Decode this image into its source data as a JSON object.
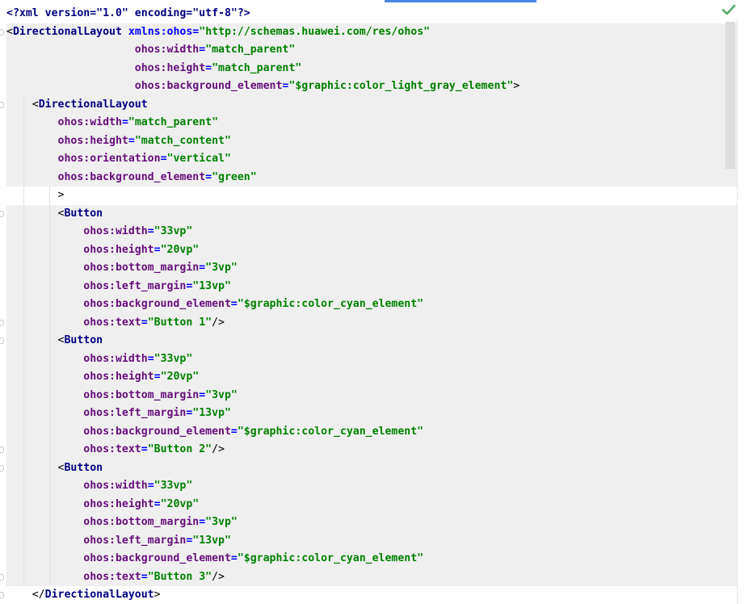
{
  "editor": {
    "status_icon": "check-icon",
    "lines": [
      [
        {
          "t": "decl",
          "v": "<?xml version=\"1.0\" encoding=\"utf-8\"?>"
        }
      ],
      [
        {
          "t": "punc",
          "v": "<"
        },
        {
          "t": "tag",
          "v": "DirectionalLayout"
        },
        {
          "t": "punc",
          "v": " "
        },
        {
          "t": "xmlns",
          "v": "xmlns:ohos"
        },
        {
          "t": "eq",
          "v": "="
        },
        {
          "t": "val",
          "v": "\"http://schemas.huawei.com/res/ohos\""
        }
      ],
      [
        {
          "t": "punc",
          "v": "                    "
        },
        {
          "t": "attr",
          "v": "ohos:width"
        },
        {
          "t": "eq",
          "v": "="
        },
        {
          "t": "val",
          "v": "\"match_parent\""
        }
      ],
      [
        {
          "t": "punc",
          "v": "                    "
        },
        {
          "t": "attr",
          "v": "ohos:height"
        },
        {
          "t": "eq",
          "v": "="
        },
        {
          "t": "val",
          "v": "\"match_parent\""
        }
      ],
      [
        {
          "t": "punc",
          "v": "                    "
        },
        {
          "t": "attr",
          "v": "ohos:background_element"
        },
        {
          "t": "eq",
          "v": "="
        },
        {
          "t": "val",
          "v": "\"$graphic:color_light_gray_element\""
        },
        {
          "t": "punc",
          "v": ">"
        }
      ],
      [
        {
          "t": "punc",
          "v": "    <"
        },
        {
          "t": "tag",
          "v": "DirectionalLayout"
        }
      ],
      [
        {
          "t": "punc",
          "v": "        "
        },
        {
          "t": "attr",
          "v": "ohos:width"
        },
        {
          "t": "eq",
          "v": "="
        },
        {
          "t": "val",
          "v": "\"match_parent\""
        }
      ],
      [
        {
          "t": "punc",
          "v": "        "
        },
        {
          "t": "attr",
          "v": "ohos:height"
        },
        {
          "t": "eq",
          "v": "="
        },
        {
          "t": "val",
          "v": "\"match_content\""
        }
      ],
      [
        {
          "t": "punc",
          "v": "        "
        },
        {
          "t": "attr",
          "v": "ohos:orientation"
        },
        {
          "t": "eq",
          "v": "="
        },
        {
          "t": "val",
          "v": "\"vertical\""
        }
      ],
      [
        {
          "t": "punc",
          "v": "        "
        },
        {
          "t": "attr",
          "v": "ohos:background_element"
        },
        {
          "t": "eq",
          "v": "="
        },
        {
          "t": "val",
          "v": "\"green\""
        }
      ],
      [
        {
          "t": "punc",
          "v": "        >"
        }
      ],
      [
        {
          "t": "punc",
          "v": "        <"
        },
        {
          "t": "tag",
          "v": "Button"
        }
      ],
      [
        {
          "t": "punc",
          "v": "            "
        },
        {
          "t": "attr",
          "v": "ohos:width"
        },
        {
          "t": "eq",
          "v": "="
        },
        {
          "t": "val",
          "v": "\"33vp\""
        }
      ],
      [
        {
          "t": "punc",
          "v": "            "
        },
        {
          "t": "attr",
          "v": "ohos:height"
        },
        {
          "t": "eq",
          "v": "="
        },
        {
          "t": "val",
          "v": "\"20vp\""
        }
      ],
      [
        {
          "t": "punc",
          "v": "            "
        },
        {
          "t": "attr",
          "v": "ohos:bottom_margin"
        },
        {
          "t": "eq",
          "v": "="
        },
        {
          "t": "val",
          "v": "\"3vp\""
        }
      ],
      [
        {
          "t": "punc",
          "v": "            "
        },
        {
          "t": "attr",
          "v": "ohos:left_margin"
        },
        {
          "t": "eq",
          "v": "="
        },
        {
          "t": "val",
          "v": "\"13vp\""
        }
      ],
      [
        {
          "t": "punc",
          "v": "            "
        },
        {
          "t": "attr",
          "v": "ohos:background_element"
        },
        {
          "t": "eq",
          "v": "="
        },
        {
          "t": "val",
          "v": "\"$graphic:color_cyan_element\""
        }
      ],
      [
        {
          "t": "punc",
          "v": "            "
        },
        {
          "t": "attr",
          "v": "ohos:text"
        },
        {
          "t": "eq",
          "v": "="
        },
        {
          "t": "val",
          "v": "\"Button 1\""
        },
        {
          "t": "punc",
          "v": "/>"
        }
      ],
      [
        {
          "t": "punc",
          "v": "        <"
        },
        {
          "t": "tag",
          "v": "Button"
        }
      ],
      [
        {
          "t": "punc",
          "v": "            "
        },
        {
          "t": "attr",
          "v": "ohos:width"
        },
        {
          "t": "eq",
          "v": "="
        },
        {
          "t": "val",
          "v": "\"33vp\""
        }
      ],
      [
        {
          "t": "punc",
          "v": "            "
        },
        {
          "t": "attr",
          "v": "ohos:height"
        },
        {
          "t": "eq",
          "v": "="
        },
        {
          "t": "val",
          "v": "\"20vp\""
        }
      ],
      [
        {
          "t": "punc",
          "v": "            "
        },
        {
          "t": "attr",
          "v": "ohos:bottom_margin"
        },
        {
          "t": "eq",
          "v": "="
        },
        {
          "t": "val",
          "v": "\"3vp\""
        }
      ],
      [
        {
          "t": "punc",
          "v": "            "
        },
        {
          "t": "attr",
          "v": "ohos:left_margin"
        },
        {
          "t": "eq",
          "v": "="
        },
        {
          "t": "val",
          "v": "\"13vp\""
        }
      ],
      [
        {
          "t": "punc",
          "v": "            "
        },
        {
          "t": "attr",
          "v": "ohos:background_element"
        },
        {
          "t": "eq",
          "v": "="
        },
        {
          "t": "val",
          "v": "\"$graphic:color_cyan_element\""
        }
      ],
      [
        {
          "t": "punc",
          "v": "            "
        },
        {
          "t": "attr",
          "v": "ohos:text"
        },
        {
          "t": "eq",
          "v": "="
        },
        {
          "t": "val",
          "v": "\"Button 2\""
        },
        {
          "t": "punc",
          "v": "/>"
        }
      ],
      [
        {
          "t": "punc",
          "v": "        <"
        },
        {
          "t": "tag",
          "v": "Button"
        }
      ],
      [
        {
          "t": "punc",
          "v": "            "
        },
        {
          "t": "attr",
          "v": "ohos:width"
        },
        {
          "t": "eq",
          "v": "="
        },
        {
          "t": "val",
          "v": "\"33vp\""
        }
      ],
      [
        {
          "t": "punc",
          "v": "            "
        },
        {
          "t": "attr",
          "v": "ohos:height"
        },
        {
          "t": "eq",
          "v": "="
        },
        {
          "t": "val",
          "v": "\"20vp\""
        }
      ],
      [
        {
          "t": "punc",
          "v": "            "
        },
        {
          "t": "attr",
          "v": "ohos:bottom_margin"
        },
        {
          "t": "eq",
          "v": "="
        },
        {
          "t": "val",
          "v": "\"3vp\""
        }
      ],
      [
        {
          "t": "punc",
          "v": "            "
        },
        {
          "t": "attr",
          "v": "ohos:left_margin"
        },
        {
          "t": "eq",
          "v": "="
        },
        {
          "t": "val",
          "v": "\"13vp\""
        }
      ],
      [
        {
          "t": "punc",
          "v": "            "
        },
        {
          "t": "attr",
          "v": "ohos:background_element"
        },
        {
          "t": "eq",
          "v": "="
        },
        {
          "t": "val",
          "v": "\"$graphic:color_cyan_element\""
        }
      ],
      [
        {
          "t": "punc",
          "v": "            "
        },
        {
          "t": "attr",
          "v": "ohos:text"
        },
        {
          "t": "eq",
          "v": "="
        },
        {
          "t": "val",
          "v": "\"Button 3\""
        },
        {
          "t": "punc",
          "v": "/>"
        }
      ],
      [
        {
          "t": "punc",
          "v": "    </"
        },
        {
          "t": "tag",
          "v": "DirectionalLayout"
        },
        {
          "t": "punc",
          "v": ">"
        }
      ]
    ],
    "highlighted_lines": [
      1,
      2,
      3,
      4,
      5,
      6,
      7,
      8,
      9,
      11,
      12,
      13,
      14,
      15,
      16,
      17,
      18,
      19,
      20,
      21,
      22,
      23,
      24,
      25,
      26,
      27,
      28,
      29,
      30,
      31
    ],
    "colors": {
      "tag": "#000080",
      "attribute": "#660e7a",
      "value": "#008000",
      "highlight": "#efefef",
      "check": "#59a869"
    }
  }
}
